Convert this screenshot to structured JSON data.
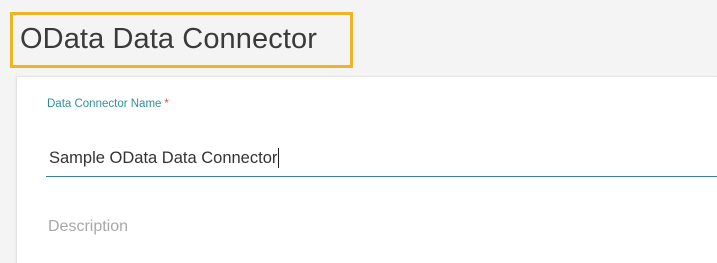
{
  "header": {
    "title": "OData Data Connector",
    "highlight_color": "#f0b323"
  },
  "form": {
    "name_field": {
      "label": "Data Connector Name",
      "required_marker": "*",
      "value": "Sample OData Data Connector"
    },
    "description_field": {
      "placeholder": "Description",
      "value": ""
    }
  },
  "colors": {
    "label": "#2f8f9d",
    "required": "#e05252",
    "input_underline": "#3a7ca5"
  }
}
